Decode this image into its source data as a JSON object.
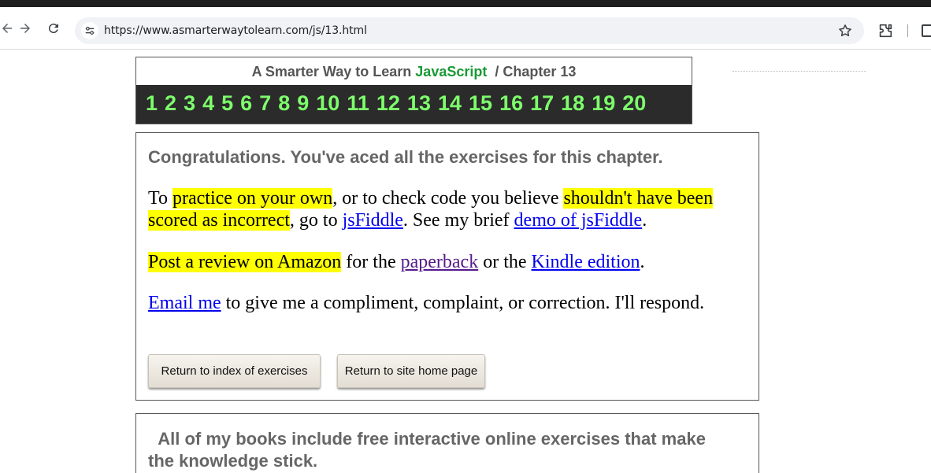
{
  "browser": {
    "url": "https://www.asmarterwaytolearn.com/js/13.html"
  },
  "header": {
    "title_prefix": "A Smarter Way to Learn ",
    "title_js": "JavaScript",
    "title_suffix": "/ Chapter 13",
    "chapters": [
      "1",
      "2",
      "3",
      "4",
      "5",
      "6",
      "7",
      "8",
      "9",
      "10",
      "11",
      "12",
      "13",
      "14",
      "15",
      "16",
      "17",
      "18",
      "19",
      "20"
    ]
  },
  "main": {
    "congrats": "Congratulations. You've aced all the exercises for this chapter.",
    "p1": {
      "t1": "To ",
      "hl1": "practice on your own",
      "t2": ", or to check code you believe ",
      "hl2": "shouldn't have been scored as incorrect",
      "t3": ", go to ",
      "link1": "jsFiddle",
      "t4": ". See my brief ",
      "link2": "demo of jsFiddle",
      "t5": "."
    },
    "p2": {
      "hl": "Post a review on Amazon",
      "t1": " for the ",
      "link1": "paperback",
      "t2": " or the ",
      "link2": "Kindle edition",
      "t3": "."
    },
    "p3": {
      "link": "Email me",
      "t1": " to give me a compliment, complaint, or correction. I'll respond."
    },
    "buttons": {
      "index": "Return to index of exercises",
      "home": "Return to site home page"
    }
  },
  "bottom": {
    "text": "All of my books include free interactive online exercises that make the knowledge stick."
  }
}
